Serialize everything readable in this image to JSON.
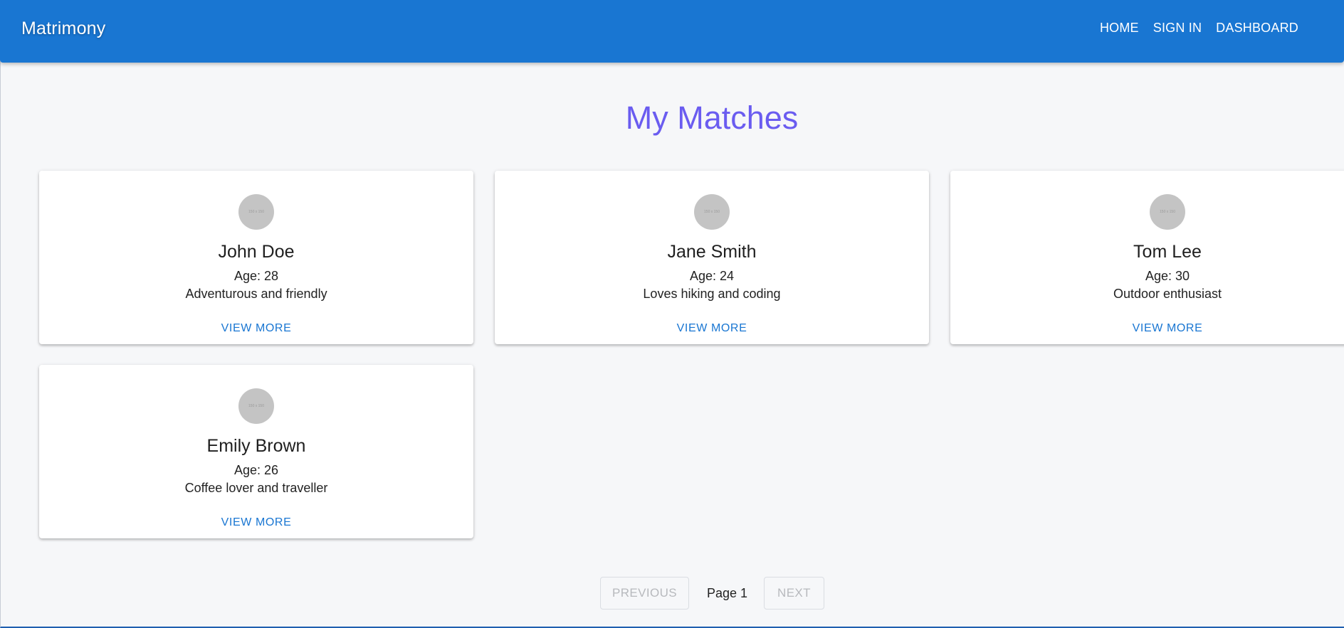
{
  "appbar": {
    "brand": "Matrimony",
    "nav": [
      {
        "label": "HOME"
      },
      {
        "label": "SIGN IN"
      },
      {
        "label": "DASHBOARD"
      }
    ]
  },
  "main": {
    "title": "My Matches",
    "cards": [
      {
        "avatar_text": "150 x 150",
        "name": "John Doe",
        "age": "Age: 28",
        "bio": "Adventurous and friendly",
        "action": "VIEW MORE"
      },
      {
        "avatar_text": "150 x 150",
        "name": "Jane Smith",
        "age": "Age: 24",
        "bio": "Loves hiking and coding",
        "action": "VIEW MORE"
      },
      {
        "avatar_text": "150 x 150",
        "name": "Tom Lee",
        "age": "Age: 30",
        "bio": "Outdoor enthusiast",
        "action": "VIEW MORE"
      },
      {
        "avatar_text": "150 x 150",
        "name": "Emily Brown",
        "age": "Age: 26",
        "bio": "Coffee lover and traveller",
        "action": "VIEW MORE"
      }
    ]
  },
  "pagination": {
    "previous_label": "PREVIOUS",
    "page_label": "Page 1",
    "next_label": "NEXT"
  },
  "colors": {
    "appbar": "#1976d2",
    "title": "#6a5cf0",
    "link": "#1976d2"
  }
}
